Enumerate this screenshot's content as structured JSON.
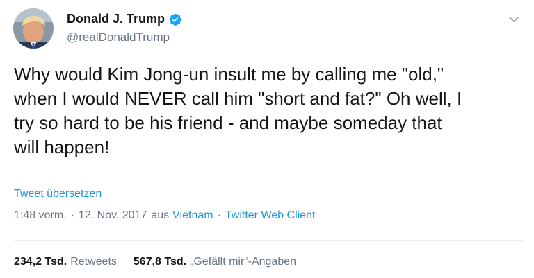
{
  "user": {
    "display_name": "Donald J. Trump",
    "handle": "@realDonaldTrump",
    "verified": true
  },
  "tweet": {
    "text": "Why would Kim Jong-un insult me by calling me \"old,\"\nwhen I would NEVER call him \"short and fat?\" Oh well, I\ntry so hard to be his friend - and maybe someday that\nwill happen!",
    "translate_label": "Tweet übersetzen",
    "time": "1:48 vorm.",
    "date": "12. Nov. 2017",
    "location_prefix": "aus",
    "location": "Vietnam",
    "client": "Twitter Web Client",
    "separator": "·"
  },
  "stats": {
    "retweets_count": "234,2 Tsd.",
    "retweets_label": "Retweets",
    "likes_count": "567,8 Tsd.",
    "likes_label": "„Gefällt mir“-Angaben"
  },
  "colors": {
    "link": "#1b95e0",
    "secondary": "#657786",
    "primary": "#14171a",
    "verified": "#1da1f2"
  },
  "icons": {
    "verified": "verified-badge-icon",
    "menu": "chevron-down-icon"
  }
}
